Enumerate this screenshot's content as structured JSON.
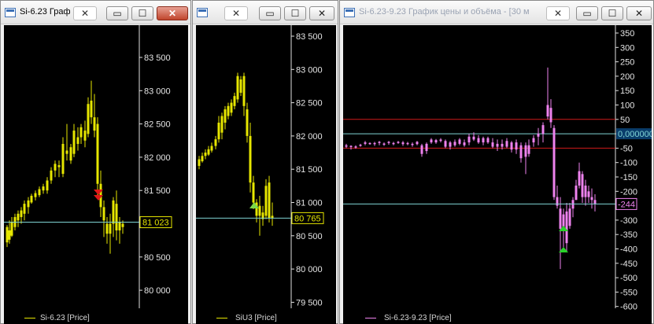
{
  "windows": [
    {
      "title": "Si-6.23 Граф",
      "title_inactive": false,
      "legend": "Si-6.23 [Price]",
      "legend_color": "#e6e600",
      "price_label": "81 023",
      "price_label_color": "#e6e600",
      "hline_color": "#7fd4d4",
      "axis_ticks": [
        "83 500",
        "83 000",
        "82 500",
        "82 000",
        "81 500",
        "81 000",
        "80 500",
        "80 000"
      ],
      "marker": "red-down-arrows"
    },
    {
      "title": "",
      "title_inactive": true,
      "legend": "SiU3 [Price]",
      "legend_color": "#e6e600",
      "price_label": "80 765",
      "price_label_color": "#e6e600",
      "hline_color": "#7fd4d4",
      "axis_ticks": [
        "83 500",
        "83 000",
        "82 500",
        "82 000",
        "81 500",
        "81 000",
        "80 500",
        "80 000",
        "79 500"
      ],
      "marker": "green-up-arrow"
    },
    {
      "title": "Si-6.23-9.23 График цены и объёма - [30 м",
      "title_inactive": true,
      "legend": "Si-6.23-9.23 [Price]",
      "legend_color": "#ee82ee",
      "price_label": "-244",
      "price_label_color": "#ee82ee",
      "zero_label": "0,000000",
      "zero_label_color": "#7fd4d4",
      "hline_color": "#7fd4d4",
      "red_line_color": "#d01a1a",
      "axis_ticks": [
        "350",
        "300",
        "250",
        "200",
        "150",
        "100",
        "50",
        "0",
        "-50",
        "-100",
        "-150",
        "-200",
        "-250",
        "-300",
        "-350",
        "-400",
        "-450",
        "-500",
        "-550",
        "-600"
      ],
      "marker": "green-up-arrows"
    }
  ],
  "titlebar_buttons": {
    "pin": "✕",
    "minimize": "▭",
    "maximize": "☐",
    "close": "✕"
  }
}
